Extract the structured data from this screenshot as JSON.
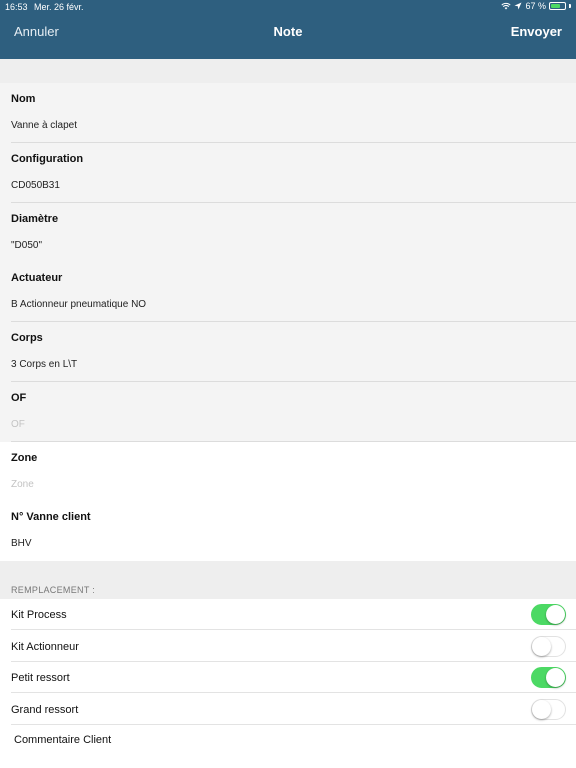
{
  "status_bar": {
    "time": "16:53",
    "date": "Mer. 26 févr.",
    "battery_text": "67 %",
    "battery_level": 0.67,
    "wifi_icon": "wifi-icon",
    "location_icon": "location-arrow-icon"
  },
  "nav": {
    "cancel_label": "Annuler",
    "title": "Note",
    "send_label": "Envoyer",
    "bar_color": "#2e5f7f"
  },
  "fields": [
    {
      "label": "Nom",
      "value": "Vanne à clapet",
      "placeholder": false
    },
    {
      "label": "Configuration",
      "value": "CD050B31",
      "placeholder": false
    },
    {
      "label": "Diamètre",
      "value": "\"D050\"",
      "placeholder": false
    },
    {
      "label": "Actuateur",
      "value": "B Actionneur pneumatique NO",
      "placeholder": false
    },
    {
      "label": "Corps",
      "value": "3 Corps en L\\T",
      "placeholder": false
    },
    {
      "label": "OF",
      "value": "OF",
      "placeholder": true
    },
    {
      "label": "Zone",
      "value": "Zone",
      "placeholder": true
    },
    {
      "label": "N° Vanne client",
      "value": "BHV",
      "placeholder": false
    }
  ],
  "replacement": {
    "header": "REMPLACEMENT :",
    "toggles": [
      {
        "label": "Kit Process",
        "on": true
      },
      {
        "label": "Kit Actionneur",
        "on": false
      },
      {
        "label": "Petit ressort",
        "on": true
      },
      {
        "label": "Grand ressort",
        "on": false
      }
    ]
  },
  "comment": {
    "label": "Commentaire Client"
  },
  "colors": {
    "toggle_on": "#4cd964",
    "accent": "#2e5f7f"
  }
}
